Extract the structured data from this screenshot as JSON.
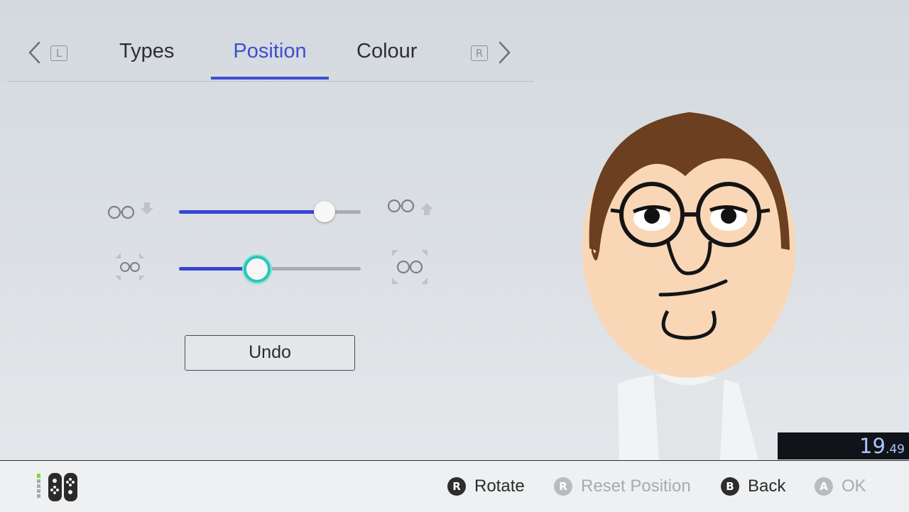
{
  "tabs": {
    "left_button": "L",
    "right_button": "R",
    "items": [
      {
        "label": "Types",
        "active": false
      },
      {
        "label": "Position",
        "active": true
      },
      {
        "label": "Colour",
        "active": false
      }
    ]
  },
  "sliders": [
    {
      "name": "vertical-position",
      "left_icon": "glasses-move-down-icon",
      "right_icon": "glasses-move-up-icon",
      "value": 0.8
    },
    {
      "name": "size",
      "left_icon": "glasses-shrink-icon",
      "right_icon": "glasses-enlarge-icon",
      "value": 0.43
    }
  ],
  "undo_label": "Undo",
  "timer": {
    "main": "19",
    "fraction": ".49"
  },
  "footer": {
    "rotate": {
      "button": "R",
      "label": "Rotate"
    },
    "reset": {
      "button": "R",
      "label": "Reset Position"
    },
    "back": {
      "button": "B",
      "label": "Back"
    },
    "ok": {
      "button": "A",
      "label": "OK"
    }
  },
  "colors": {
    "accent": "#3e4ed1",
    "slider_fill": "#3745d6",
    "selected_knob_ring": "#2ec4b6",
    "hair": "#6b3f1f",
    "skin": "#f9d7b6"
  }
}
